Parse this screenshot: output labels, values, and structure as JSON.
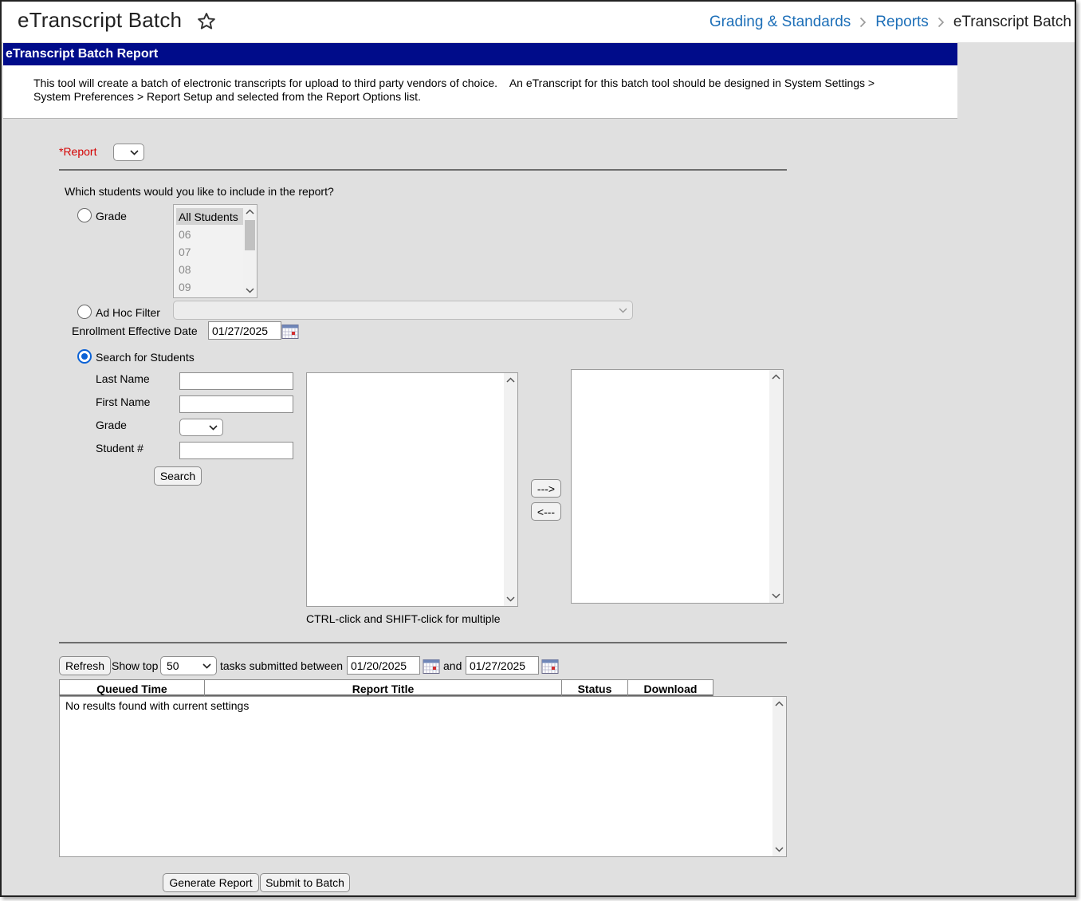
{
  "header": {
    "title": "eTranscript Batch",
    "breadcrumbs": [
      "Grading & Standards",
      "Reports"
    ],
    "current": "eTranscript Batch"
  },
  "panel": {
    "title": "eTranscript Batch Report",
    "description_line1": "This tool will create a batch of electronic transcripts for upload to third party vendors of choice.    An eTranscript for this batch tool should be designed in System Settings >",
    "description_line2": "System Preferences > Report Setup and selected from the Report Options list."
  },
  "report": {
    "label": "*Report",
    "selected": ""
  },
  "students": {
    "question": "Which students would you like to include in the report?",
    "grade_label": "Grade",
    "grade_options": [
      "All Students",
      "06",
      "07",
      "08",
      "09"
    ],
    "grade_selected": "All Students",
    "adhoc_label": "Ad Hoc Filter",
    "adhoc_selected": "",
    "enrollment_label": "Enrollment Effective Date",
    "enrollment_date": "01/27/2025",
    "search_label": "Search for Students",
    "selected_mode": "search"
  },
  "search_form": {
    "last_name_label": "Last Name",
    "last_name_value": "",
    "first_name_label": "First Name",
    "first_name_value": "",
    "grade_label": "Grade",
    "grade_value": "",
    "student_num_label": "Student #",
    "student_num_value": "",
    "search_button": "Search",
    "add_button": "--->",
    "remove_button": "<---",
    "hint": "CTRL-click and SHIFT-click for multiple"
  },
  "batch": {
    "refresh_button": "Refresh",
    "show_top_label": "Show top",
    "show_top_value": "50",
    "between_label": "tasks submitted between",
    "start_date": "01/20/2025",
    "and_label": "and",
    "end_date": "01/27/2025",
    "columns": [
      "Queued Time",
      "Report Title",
      "Status",
      "Download"
    ],
    "empty_message": "No results found with current settings"
  },
  "actions": {
    "generate": "Generate Report",
    "submit": "Submit to Batch"
  },
  "colors": {
    "title_bar": "#000c8a",
    "link": "#1d6fb8",
    "required": "#d40000",
    "radio_selected": "#0b62d6"
  },
  "icons": {
    "favorite": "star-outline",
    "crumb_separator": "chevron-right",
    "calendar": "calendar-icon"
  }
}
